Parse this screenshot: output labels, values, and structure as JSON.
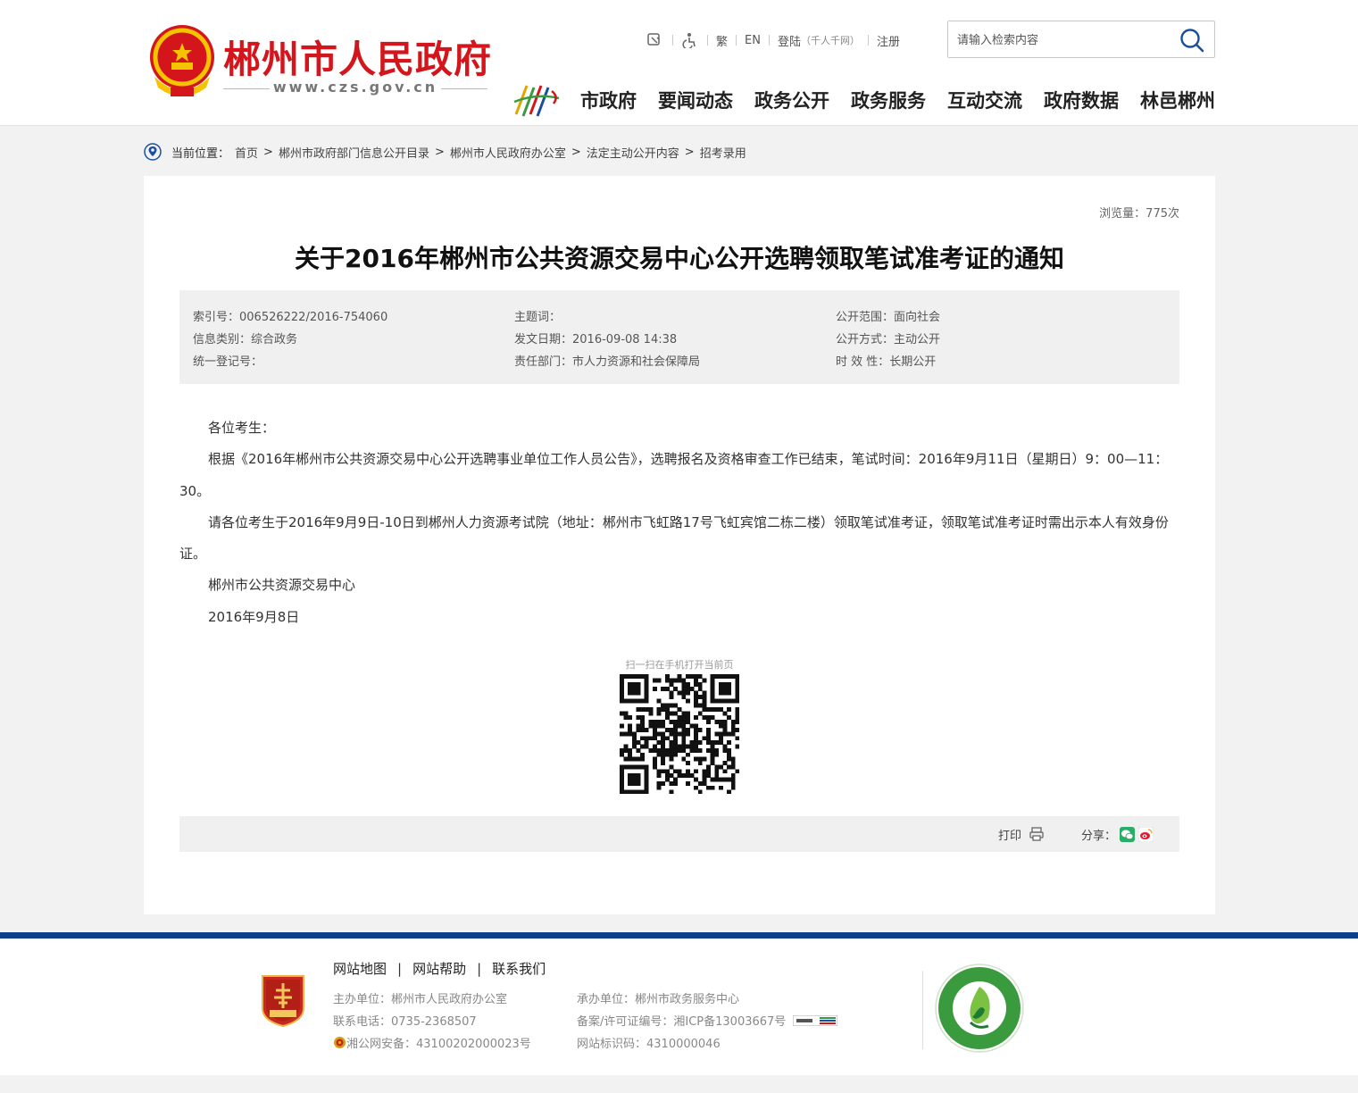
{
  "header": {
    "site_name": "郴州市人民政府",
    "site_url": "www.czs.gov.cn",
    "tools": {
      "traditional": "繁",
      "english": "EN",
      "login": "登陆",
      "login_note": "（千人千网）",
      "register": "注册"
    },
    "search": {
      "placeholder": "请输入检索内容",
      "value": ""
    },
    "nav": [
      "市政府",
      "要闻动态",
      "政务公开",
      "政务服务",
      "互动交流",
      "政府数据",
      "林邑郴州"
    ]
  },
  "breadcrumb": {
    "label": "当前位置：",
    "items": [
      "首页",
      "郴州市政府部门信息公开目录",
      "郴州市人民政府办公室",
      "法定主动公开内容",
      "招考录用"
    ],
    "separator": ">"
  },
  "article": {
    "views": "浏览量：775次",
    "title": "关于2016年郴州市公共资源交易中心公开选聘领取笔试准考证的通知",
    "meta": {
      "index_no": "索引号：006526222/2016-754060",
      "keywords": "主题词：",
      "scope": "公开范围：面向社会",
      "category": "信息类别：综合政务",
      "issue_date": "发文日期：2016-09-08 14:38",
      "method": "公开方式：主动公开",
      "reg_no": "统一登记号：",
      "department": "责任部门：市人力资源和社会保障局",
      "validity": "时 效 性：长期公开"
    },
    "paragraphs": [
      "各位考生：",
      "根据《2016年郴州市公共资源交易中心公开选聘事业单位工作人员公告》，选聘报名及资格审查工作已结束，笔试时间：2016年9月11日（星期日）9：00—11：30。",
      "请各位考生于2016年9月9日-10日到郴州人力资源考试院（地址：郴州市飞虹路17号飞虹宾馆二栋二楼）领取笔试准考证，领取笔试准考证时需出示本人有效身份证。",
      "郴州市公共资源交易中心",
      "2016年9月8日"
    ],
    "qr_caption": "扫一扫在手机打开当前页",
    "print_label": "打印",
    "share_label": "分享："
  },
  "footer": {
    "links": [
      "网站地图",
      "网站帮助",
      "联系我们"
    ],
    "sponsor": "主办单位：郴州市人民政府办公室",
    "phone": "联系电话：0735-2368507",
    "police": "湘公网安备：43100202000023号",
    "organizer": "承办单位：郴州市政务服务中心",
    "icp": "备案/许可证编号：湘ICP备13003667号",
    "site_code": "网站标识码：4310000046"
  },
  "colors": {
    "brand_red": "#d4161c",
    "footer_blue": "#0d3f8a",
    "civ_green": "#3a9a3e"
  },
  "icons": [
    "emblem-icon",
    "barrier-free-icon",
    "accessibility-icon",
    "search-icon",
    "location-pin-icon",
    "qr-code",
    "print-icon",
    "wechat-icon",
    "weibo-icon",
    "party-organ-badge",
    "civilization-badge"
  ]
}
